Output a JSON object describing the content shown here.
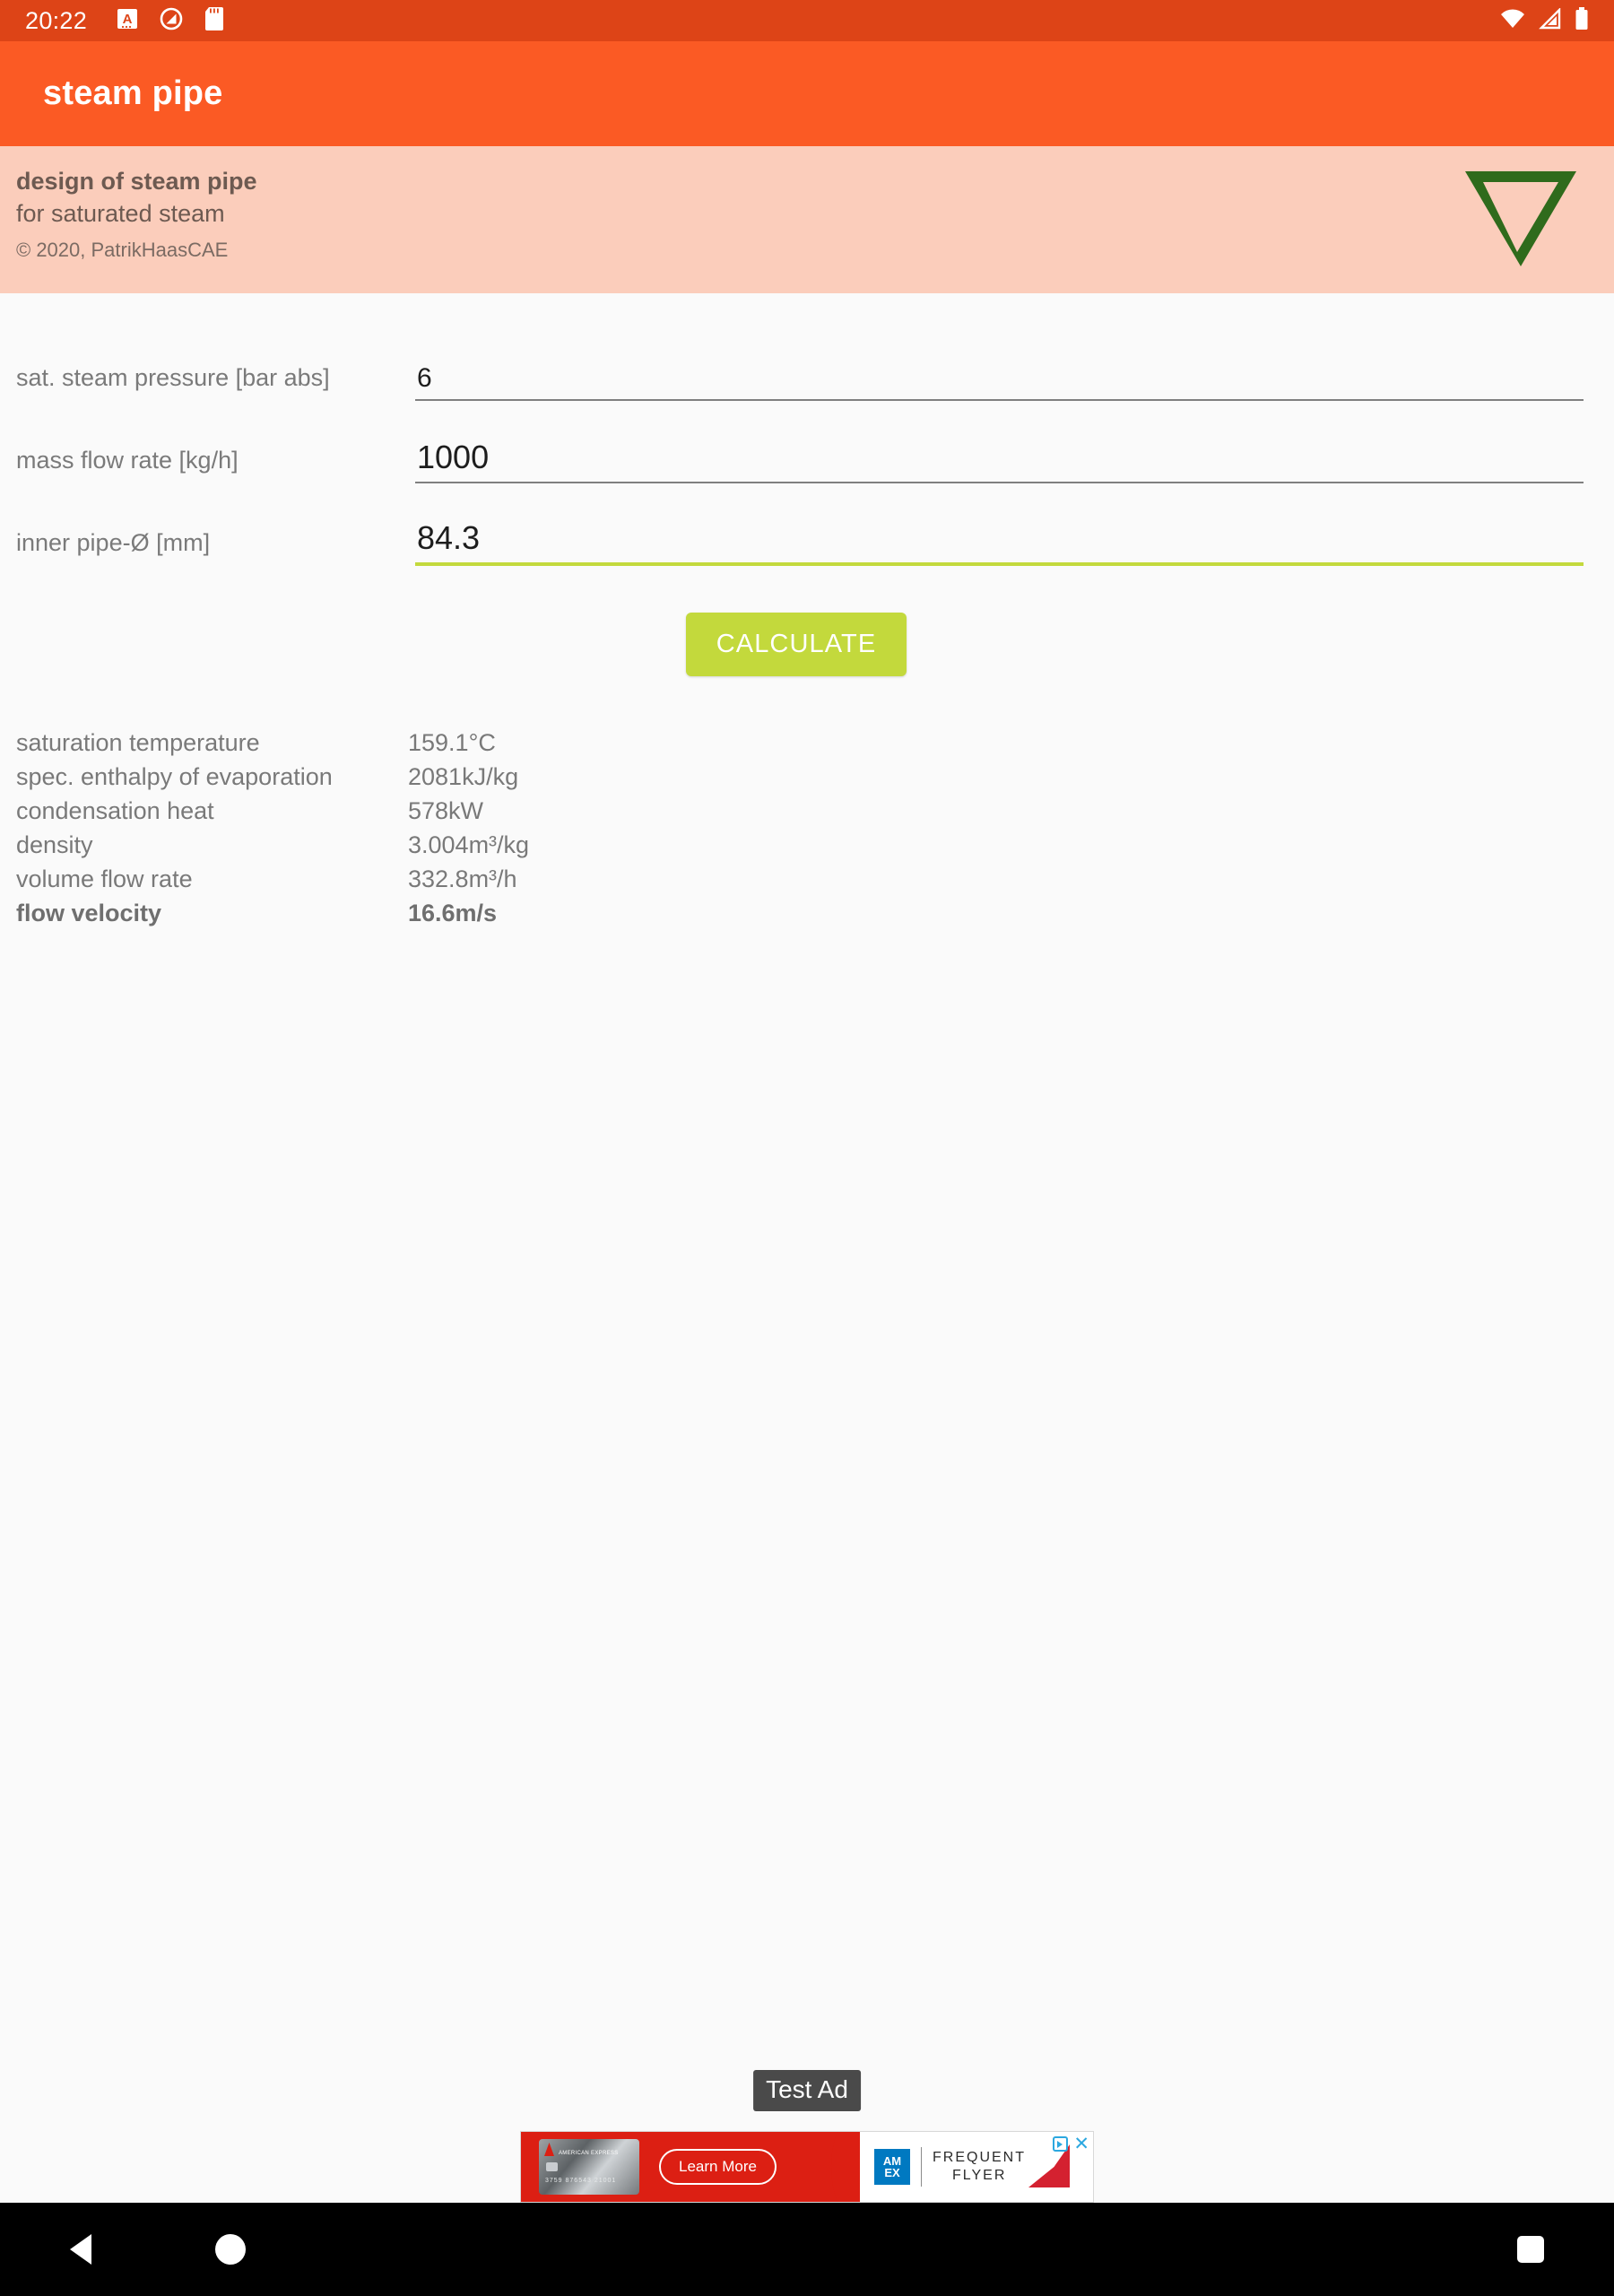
{
  "status_bar": {
    "time": "20:22",
    "left_icons": [
      "alphabet-a-icon",
      "do-not-disturb-icon",
      "sd-card-icon"
    ],
    "right_icons": [
      "wifi-icon",
      "cell-signal-icon",
      "battery-icon"
    ],
    "background": "#dd4417"
  },
  "app_bar": {
    "title": "steam pipe",
    "background": "#fb5a24"
  },
  "banner": {
    "line1": "design of steam pipe",
    "line2": "for saturated steam",
    "copyright": "© 2020, PatrikHaasCAE",
    "logo": "nabla-triangle-logo",
    "logo_color": "#2f6b1c",
    "background": "#fbcdbb"
  },
  "form": {
    "fields": [
      {
        "label": "sat. steam pressure [bar abs]",
        "value": "6",
        "focused": false,
        "size": "small"
      },
      {
        "label": "mass flow rate [kg/h]",
        "value": "1000",
        "focused": false,
        "size": "large"
      },
      {
        "label": "inner pipe-Ø [mm]",
        "value": "84.3",
        "focused": true,
        "size": "large"
      }
    ],
    "calculate_label": "CALCULATE",
    "calculate_color": "#c3d93c",
    "focus_underline_color": "#c3d93c"
  },
  "results": {
    "rows": [
      {
        "label": "saturation temperature",
        "value": "159.1°C",
        "bold": false
      },
      {
        "label": "spec. enthalpy of evaporation",
        "value": "2081kJ/kg",
        "bold": false
      },
      {
        "label": "condensation heat",
        "value": "578kW",
        "bold": false
      },
      {
        "label": "density",
        "value": "3.004m³/kg",
        "bold": false
      },
      {
        "label": "volume flow rate",
        "value": "332.8m³/h",
        "bold": false
      },
      {
        "label": "flow velocity",
        "value": "16.6m/s",
        "bold": true
      }
    ]
  },
  "ad": {
    "test_label": "Test Ad",
    "cta": "Learn More",
    "card_brand": "AMERICAN EXPRESS",
    "card_number": "3759 876543 21001",
    "amex_line1": "AM",
    "amex_line2": "EX",
    "program_line1": "FREQUENT",
    "program_line2": "FLYER",
    "close_icon": "✕",
    "adchoices_icon": "adchoices-icon"
  },
  "nav_bar": {
    "back": "back-button",
    "home": "home-button",
    "recents": "recents-button"
  }
}
